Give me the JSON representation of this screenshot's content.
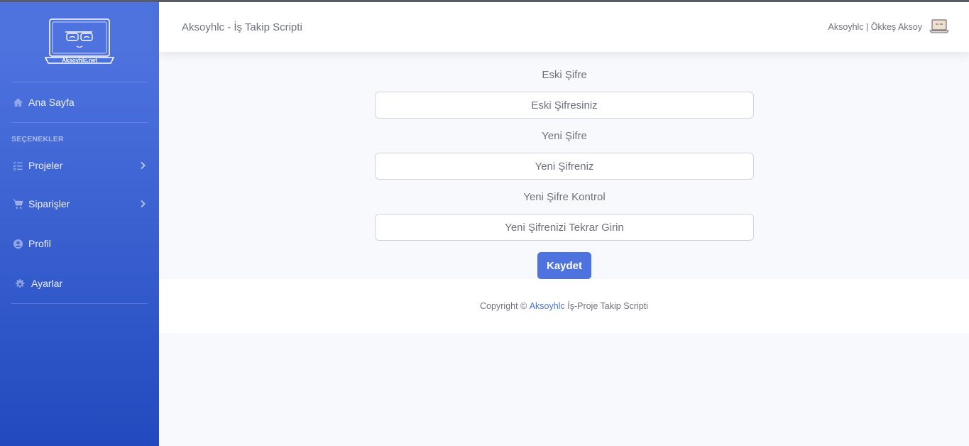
{
  "brand": {
    "logo_text": "Aksoyhlc.net"
  },
  "sidebar": {
    "items_top": [
      {
        "label": "Ana Sayfa",
        "icon": "home-icon"
      }
    ],
    "heading": "SEÇENEKLER",
    "items": [
      {
        "label": "Projeler",
        "icon": "tasks-icon",
        "expandable": true
      },
      {
        "label": "Siparişler",
        "icon": "cart-icon",
        "expandable": true
      },
      {
        "label": "Profil",
        "icon": "user-circle-icon",
        "expandable": false
      },
      {
        "label": "Ayarlar",
        "icon": "cog-icon",
        "expandable": false
      }
    ]
  },
  "topbar": {
    "title": "Aksoyhlc - İş Takip Scripti",
    "user_label": "Aksoyhlc | Ökkeş Aksoy"
  },
  "form": {
    "old_password": {
      "label": "Eski Şifre",
      "placeholder": "Eski Şifresiniz",
      "value": ""
    },
    "new_password": {
      "label": "Yeni Şifre",
      "placeholder": "Yeni Şifreniz",
      "value": ""
    },
    "confirm_password": {
      "label": "Yeni Şifre Kontrol",
      "placeholder": "Yeni Şifrenizi Tekrar Girin",
      "value": ""
    },
    "save_label": "Kaydet"
  },
  "footer": {
    "prefix": "Copyright © ",
    "link": "Aksoyhlc",
    "suffix": " İş-Proje Takip Scripti"
  },
  "colors": {
    "primary": "#4e73df",
    "sidebar_gradient_end": "#224abe",
    "text_muted": "#6e707e",
    "background": "#f8f9fc"
  }
}
